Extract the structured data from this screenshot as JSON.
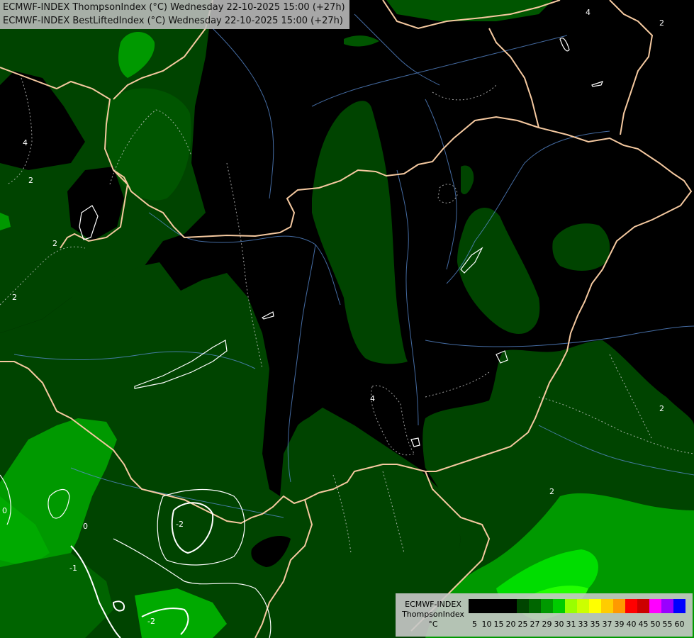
{
  "header": {
    "line1": "ECMWF-INDEX ThompsonIndex (°C) Wednesday 22-10-2025 15:00 (+27h)",
    "line2": "ECMWF-INDEX BestLiftedIndex (°C) Wednesday 22-10-2025 15:00 (+27h)"
  },
  "legend": {
    "model": "ECMWF-INDEX",
    "index": "ThompsonIndex",
    "unit": "°C",
    "values": [
      "5",
      "10",
      "15",
      "20",
      "25",
      "27",
      "29",
      "30",
      "31",
      "33",
      "35",
      "37",
      "39",
      "40",
      "45",
      "50",
      "55",
      "60"
    ],
    "colors": [
      "#000000",
      "#000000",
      "#000000",
      "#000000",
      "#004400",
      "#006400",
      "#009900",
      "#00cc00",
      "#99ff00",
      "#ccff00",
      "#ffff00",
      "#ffcc00",
      "#ff9900",
      "#ff6600",
      "#ff0000",
      "#cc0000",
      "#990000",
      "#ff00ff",
      "#cc00ff",
      "#9900ff",
      "#6600ff",
      "#0000ff"
    ]
  },
  "map": {
    "palette": {
      "black": "#000000",
      "dark_green": "#004400",
      "green": "#006400",
      "bright_green": "#009900",
      "lime": "#00cc00"
    },
    "contour_labels": [
      "4",
      "2",
      "2",
      "2",
      "4",
      "2",
      "0",
      "0",
      "-1",
      "-2",
      "-2",
      "4",
      "2",
      "2"
    ]
  }
}
